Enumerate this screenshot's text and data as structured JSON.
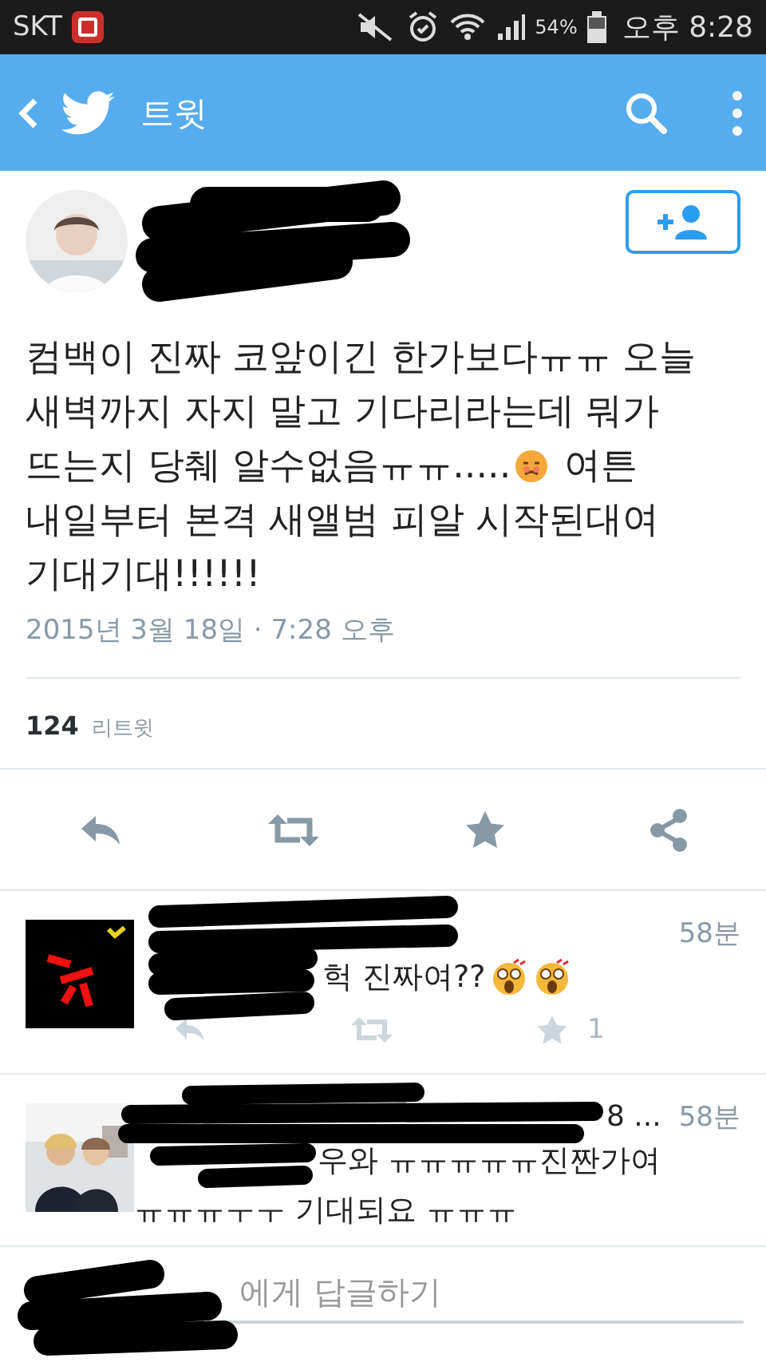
{
  "status_bar": {
    "carrier": "SKT",
    "battery": "54%",
    "time": "오후 8:28"
  },
  "header": {
    "title": "트윗"
  },
  "tweet": {
    "text_before": "컴백이 진짜 코앞이긴 한가보다ㅠㅠ 오늘 새벽까지 자지 말고 기다리라는데 뭐가 뜨는지 당췌 알수없음ㅠㅠ.....",
    "text_after": " 여튼 내일부터 본격 새앨범 피알 시작된대여 기대기대!!!!!!",
    "date": "2015년 3월 18일 · 7:28 오후",
    "retweet_count": "124",
    "retweet_label": "리트윗"
  },
  "replies": [
    {
      "kind": "emoji",
      "time": "58분",
      "text": "헉 진짜여??",
      "likes": "1"
    },
    {
      "kind": "plain",
      "name": "8 ...",
      "time": "58분",
      "text": "우와 ㅠㅠㅠㅠㅠ진짠가여 ㅠㅠㅠㅜㅜ 기대되요 ㅠㅠㅠ"
    }
  ],
  "composer": {
    "placeholder": "에게 답글하기"
  }
}
